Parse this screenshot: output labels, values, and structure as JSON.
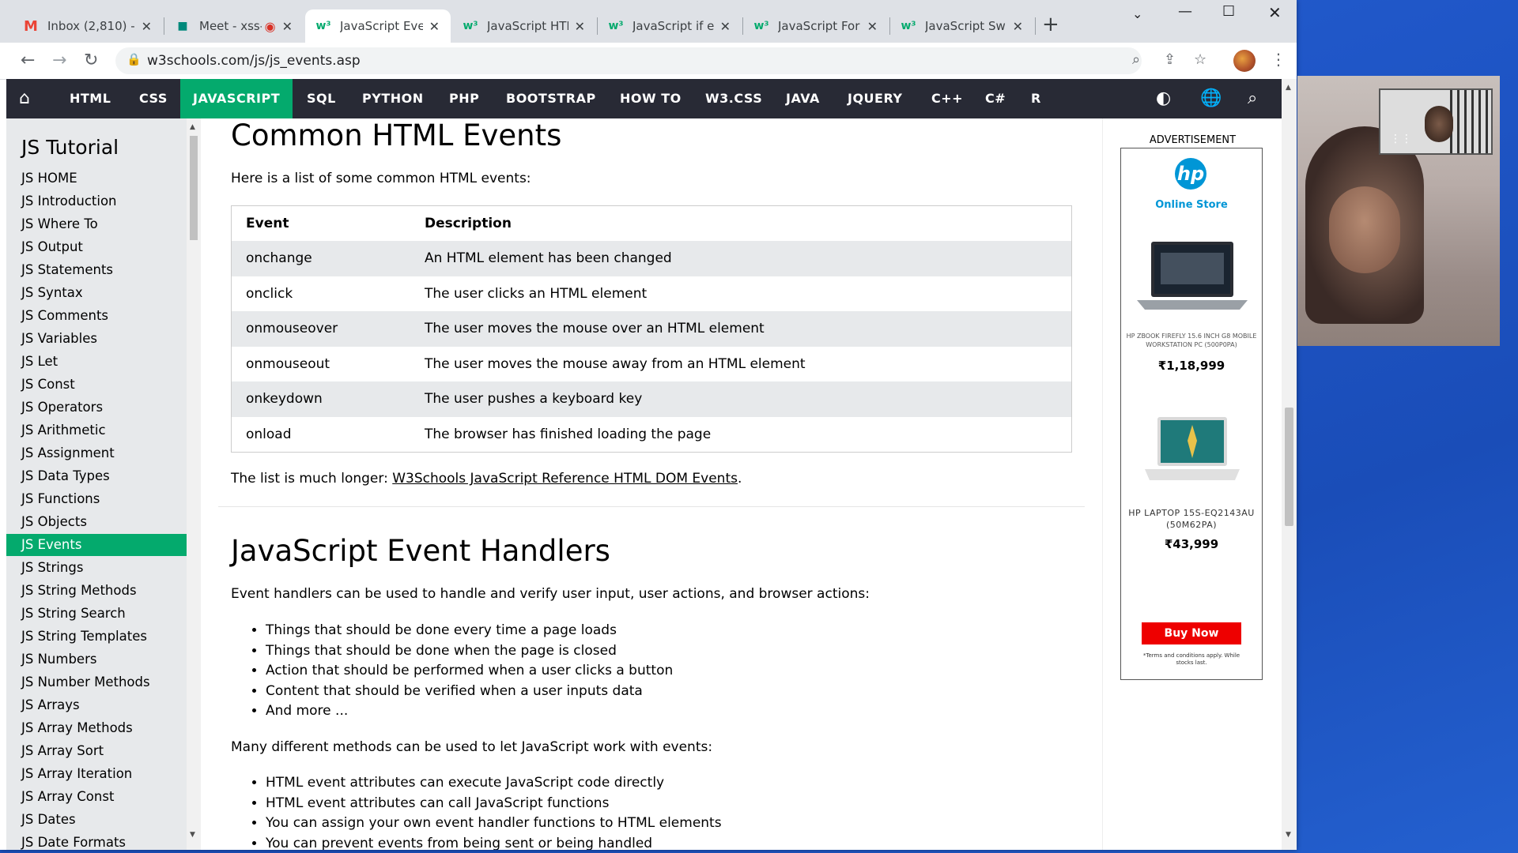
{
  "tabs": [
    {
      "title": "Inbox (2,810) -",
      "fav": "M",
      "favcolor": "#ea4335"
    },
    {
      "title": "Meet - xss-",
      "fav": "▶",
      "favcolor": "#00897b"
    },
    {
      "title": "JavaScript Even",
      "fav": "w³",
      "favcolor": "#04aa6d"
    },
    {
      "title": "JavaScript HTM",
      "fav": "w³",
      "favcolor": "#04aa6d"
    },
    {
      "title": "JavaScript if els",
      "fav": "w³",
      "favcolor": "#04aa6d"
    },
    {
      "title": "JavaScript For",
      "fav": "w³",
      "favcolor": "#04aa6d"
    },
    {
      "title": "JavaScript Swit",
      "fav": "w³",
      "favcolor": "#04aa6d"
    }
  ],
  "address": {
    "url": "w3schools.com/js/js_events.asp"
  },
  "topnav": [
    "HTML",
    "CSS",
    "JAVASCRIPT",
    "SQL",
    "PYTHON",
    "PHP",
    "BOOTSTRAP",
    "HOW TO",
    "W3.CSS",
    "JAVA",
    "JQUERY",
    "C++",
    "C#",
    "R"
  ],
  "sidebar": {
    "title": "JS Tutorial",
    "items": [
      "JS HOME",
      "JS Introduction",
      "JS Where To",
      "JS Output",
      "JS Statements",
      "JS Syntax",
      "JS Comments",
      "JS Variables",
      "JS Let",
      "JS Const",
      "JS Operators",
      "JS Arithmetic",
      "JS Assignment",
      "JS Data Types",
      "JS Functions",
      "JS Objects",
      "JS Events",
      "JS Strings",
      "JS String Methods",
      "JS String Search",
      "JS String Templates",
      "JS Numbers",
      "JS Number Methods",
      "JS Arrays",
      "JS Array Methods",
      "JS Array Sort",
      "JS Array Iteration",
      "JS Array Const",
      "JS Dates",
      "JS Date Formats"
    ],
    "active": "JS Events"
  },
  "main": {
    "h1_common": "Common HTML Events",
    "intro": "Here is a list of some common HTML events:",
    "table": {
      "headers": [
        "Event",
        "Description"
      ],
      "rows": [
        [
          "onchange",
          "An HTML element has been changed"
        ],
        [
          "onclick",
          "The user clicks an HTML element"
        ],
        [
          "onmouseover",
          "The user moves the mouse over an HTML element"
        ],
        [
          "onmouseout",
          "The user moves the mouse away from an HTML element"
        ],
        [
          "onkeydown",
          "The user pushes a keyboard key"
        ],
        [
          "onload",
          "The browser has finished loading the page"
        ]
      ]
    },
    "longer_prefix": "The list is much longer: ",
    "longer_link": "W3Schools JavaScript Reference HTML DOM Events",
    "longer_suffix": ".",
    "h1_handlers": "JavaScript Event Handlers",
    "handlers_intro": "Event handlers can be used to handle and verify user input, user actions, and browser actions:",
    "list1": [
      "Things that should be done every time a page loads",
      "Things that should be done when the page is closed",
      "Action that should be performed when a user clicks a button",
      "Content that should be verified when a user inputs data",
      "And more ..."
    ],
    "methods_intro": "Many different methods can be used to let JavaScript work with events:",
    "list2": [
      "HTML event attributes can execute JavaScript code directly",
      "HTML event attributes can call JavaScript functions",
      "You can assign your own event handler functions to HTML elements",
      "You can prevent events from being sent or being handled"
    ]
  },
  "ad": {
    "label": "ADVERTISEMENT",
    "logo": "hp",
    "store": "Online Store",
    "p1_name": "HP ZBOOK FIREFLY 15.6 INCH G8 MOBILE WORKSTATION PC (500P0PA)",
    "p1_price": "₹1,18,999",
    "p2_name": "HP LAPTOP 15S-EQ2143AU (50M62PA)",
    "p2_price": "₹43,999",
    "buy": "Buy Now",
    "terms": "*Terms and conditions apply. While stocks last."
  },
  "colors": {
    "accent": "#04aa6d",
    "navbar": "#282a35",
    "sidebar": "#e7e9eb"
  }
}
